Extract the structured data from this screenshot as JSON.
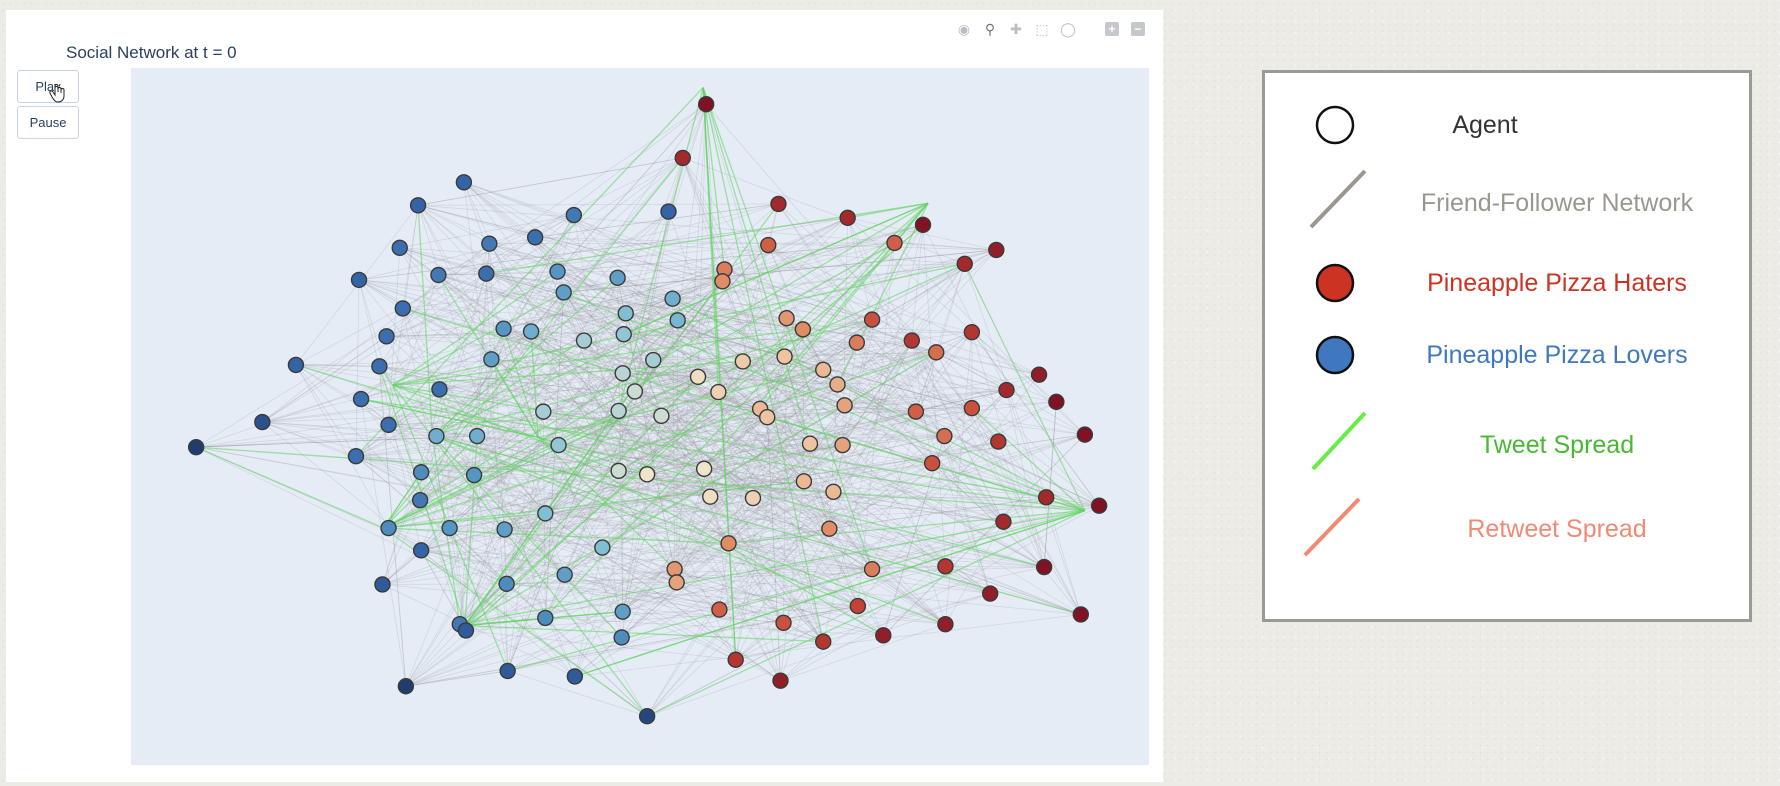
{
  "figure": {
    "title": "Social Network at t = 0",
    "controls": {
      "play_label": "Play",
      "pause_label": "Pause"
    },
    "modebar": [
      "camera-icon",
      "zoom-icon",
      "pan-icon",
      "box-select-icon",
      "lasso-icon",
      "zoom-in-icon",
      "zoom-out-icon"
    ],
    "colors": {
      "plot_bg": "#e5ecf6",
      "edge": "#9a9a9a",
      "tweet_edge": "#5fd35f",
      "node_outline": "#3a3a3a"
    }
  },
  "legend": {
    "items": [
      {
        "label": "Agent",
        "symbol": "circle-icon",
        "color": "#333333"
      },
      {
        "label": "Friend-Follower Network",
        "symbol": "grey-line-icon",
        "color": "#9a9790"
      },
      {
        "label": "Pineapple Pizza Haters",
        "symbol": "red-circle-icon",
        "color": "#cc3322"
      },
      {
        "label": "Pineapple Pizza Lovers",
        "symbol": "blue-circle-icon",
        "color": "#3f78bf"
      },
      {
        "label": "Tweet Spread",
        "symbol": "green-line-icon",
        "color": "#48b830"
      },
      {
        "label": "Retweet Spread",
        "symbol": "salmon-line-icon",
        "color": "#f08a75"
      }
    ]
  },
  "chart_data": {
    "type": "network",
    "title": "Social Network at t = 0",
    "xlim": [
      0,
      100
    ],
    "ylim": [
      0,
      100
    ],
    "grid": false,
    "opinion_scale": "opinion in [-1, 1]: -1 = dark blue (Pineapple Pizza Lovers), 0 = pale cream, +1 = dark red (Pineapple Pizza Haters)",
    "nodes": [
      {
        "x": 56.5,
        "y": 94.8,
        "o": 1.0
      },
      {
        "x": 6.4,
        "y": 45.6,
        "o": -1.0
      },
      {
        "x": 12.9,
        "y": 49.2,
        "o": -0.9
      },
      {
        "x": 16.2,
        "y": 57.4,
        "o": -0.8
      },
      {
        "x": 22.4,
        "y": 69.6,
        "o": -0.8
      },
      {
        "x": 32.7,
        "y": 83.6,
        "o": -0.8
      },
      {
        "x": 28.2,
        "y": 80.3,
        "o": -0.8
      },
      {
        "x": 43.5,
        "y": 78.9,
        "o": -0.7
      },
      {
        "x": 52.8,
        "y": 79.4,
        "o": -0.8
      },
      {
        "x": 54.2,
        "y": 87.1,
        "o": 0.9
      },
      {
        "x": 63.6,
        "y": 80.5,
        "o": 0.9
      },
      {
        "x": 70.4,
        "y": 78.5,
        "o": 0.9
      },
      {
        "x": 77.8,
        "y": 77.5,
        "o": 1.0
      },
      {
        "x": 85.0,
        "y": 73.9,
        "o": 0.95
      },
      {
        "x": 81.9,
        "y": 71.9,
        "o": 0.9
      },
      {
        "x": 62.6,
        "y": 74.6,
        "o": 0.7
      },
      {
        "x": 58.3,
        "y": 71.1,
        "o": 0.6
      },
      {
        "x": 39.7,
        "y": 75.7,
        "o": -0.75
      },
      {
        "x": 26.4,
        "y": 74.2,
        "o": -0.75
      },
      {
        "x": 35.2,
        "y": 74.8,
        "o": -0.7
      },
      {
        "x": 30.2,
        "y": 70.3,
        "o": -0.7
      },
      {
        "x": 41.9,
        "y": 70.8,
        "o": -0.55
      },
      {
        "x": 47.8,
        "y": 69.9,
        "o": -0.5
      },
      {
        "x": 53.2,
        "y": 66.9,
        "o": -0.4
      },
      {
        "x": 48.6,
        "y": 64.8,
        "o": -0.3
      },
      {
        "x": 42.5,
        "y": 67.8,
        "o": -0.5
      },
      {
        "x": 34.9,
        "y": 70.5,
        "o": -0.75
      },
      {
        "x": 26.7,
        "y": 65.5,
        "o": -0.75
      },
      {
        "x": 25.1,
        "y": 61.5,
        "o": -0.75
      },
      {
        "x": 36.6,
        "y": 62.6,
        "o": -0.55
      },
      {
        "x": 39.3,
        "y": 62.2,
        "o": -0.4
      },
      {
        "x": 35.4,
        "y": 58.2,
        "o": -0.5
      },
      {
        "x": 30.3,
        "y": 53.9,
        "o": -0.75
      },
      {
        "x": 22.6,
        "y": 52.5,
        "o": -0.75
      },
      {
        "x": 24.4,
        "y": 57.2,
        "o": -0.75
      },
      {
        "x": 44.5,
        "y": 60.9,
        "o": -0.2
      },
      {
        "x": 48.3,
        "y": 56.2,
        "o": -0.15
      },
      {
        "x": 48.4,
        "y": 61.8,
        "o": -0.25
      },
      {
        "x": 49.5,
        "y": 53.6,
        "o": -0.1
      },
      {
        "x": 53.7,
        "y": 63.8,
        "o": -0.35
      },
      {
        "x": 47.9,
        "y": 50.8,
        "o": -0.15
      },
      {
        "x": 55.7,
        "y": 55.7,
        "o": 0.1
      },
      {
        "x": 57.7,
        "y": 53.5,
        "o": 0.2
      },
      {
        "x": 60.1,
        "y": 57.9,
        "o": 0.25
      },
      {
        "x": 58.1,
        "y": 69.4,
        "o": 0.55
      },
      {
        "x": 64.4,
        "y": 64.1,
        "o": 0.5
      },
      {
        "x": 71.3,
        "y": 60.6,
        "o": 0.6
      },
      {
        "x": 64.2,
        "y": 58.6,
        "o": 0.3
      },
      {
        "x": 68.0,
        "y": 56.7,
        "o": 0.35
      },
      {
        "x": 72.8,
        "y": 63.9,
        "o": 0.75
      },
      {
        "x": 66.0,
        "y": 62.5,
        "o": 0.55
      },
      {
        "x": 76.7,
        "y": 60.9,
        "o": 0.85
      },
      {
        "x": 75.0,
        "y": 74.9,
        "o": 0.7
      },
      {
        "x": 79.1,
        "y": 59.2,
        "o": 0.65
      },
      {
        "x": 82.6,
        "y": 62.1,
        "o": 0.85
      },
      {
        "x": 82.6,
        "y": 51.2,
        "o": 0.75
      },
      {
        "x": 77.1,
        "y": 50.7,
        "o": 0.7
      },
      {
        "x": 69.4,
        "y": 54.6,
        "o": 0.4
      },
      {
        "x": 70.1,
        "y": 51.6,
        "o": 0.45
      },
      {
        "x": 61.8,
        "y": 51.1,
        "o": 0.35
      },
      {
        "x": 62.5,
        "y": 49.9,
        "o": 0.3
      },
      {
        "x": 66.7,
        "y": 46.1,
        "o": 0.3
      },
      {
        "x": 69.9,
        "y": 45.9,
        "o": 0.45
      },
      {
        "x": 79.9,
        "y": 47.2,
        "o": 0.65
      },
      {
        "x": 86.0,
        "y": 53.8,
        "o": 0.9
      },
      {
        "x": 89.2,
        "y": 56.0,
        "o": 0.95
      },
      {
        "x": 90.9,
        "y": 52.1,
        "o": 1.0
      },
      {
        "x": 93.7,
        "y": 47.4,
        "o": 1.0
      },
      {
        "x": 85.2,
        "y": 46.4,
        "o": 0.85
      },
      {
        "x": 78.7,
        "y": 43.3,
        "o": 0.75
      },
      {
        "x": 89.9,
        "y": 38.4,
        "o": 0.9
      },
      {
        "x": 95.1,
        "y": 37.2,
        "o": 1.0
      },
      {
        "x": 85.7,
        "y": 34.9,
        "o": 0.9
      },
      {
        "x": 69.0,
        "y": 39.2,
        "o": 0.35
      },
      {
        "x": 66.1,
        "y": 40.7,
        "o": 0.35
      },
      {
        "x": 61.1,
        "y": 38.3,
        "o": 0.2
      },
      {
        "x": 56.9,
        "y": 38.5,
        "o": 0.1
      },
      {
        "x": 47.9,
        "y": 42.2,
        "o": -0.1
      },
      {
        "x": 50.7,
        "y": 41.7,
        "o": 0.05
      },
      {
        "x": 56.3,
        "y": 42.5,
        "o": 0.05
      },
      {
        "x": 68.6,
        "y": 33.9,
        "o": 0.55
      },
      {
        "x": 58.7,
        "y": 31.8,
        "o": 0.55
      },
      {
        "x": 53.4,
        "y": 28.1,
        "o": 0.5
      },
      {
        "x": 72.8,
        "y": 28.1,
        "o": 0.6
      },
      {
        "x": 80.0,
        "y": 28.5,
        "o": 0.85
      },
      {
        "x": 89.7,
        "y": 28.4,
        "o": 1.0
      },
      {
        "x": 84.4,
        "y": 24.6,
        "o": 0.95
      },
      {
        "x": 93.3,
        "y": 21.6,
        "o": 1.0
      },
      {
        "x": 80.0,
        "y": 20.2,
        "o": 0.95
      },
      {
        "x": 71.4,
        "y": 22.8,
        "o": 0.8
      },
      {
        "x": 73.9,
        "y": 18.6,
        "o": 0.95
      },
      {
        "x": 68.0,
        "y": 17.7,
        "o": 0.85
      },
      {
        "x": 64.1,
        "y": 20.4,
        "o": 0.75
      },
      {
        "x": 57.8,
        "y": 22.3,
        "o": 0.7
      },
      {
        "x": 59.4,
        "y": 15.1,
        "o": 0.85
      },
      {
        "x": 63.8,
        "y": 12.1,
        "o": 0.95
      },
      {
        "x": 53.6,
        "y": 26.2,
        "o": 0.45
      },
      {
        "x": 48.3,
        "y": 22.0,
        "o": -0.5
      },
      {
        "x": 48.2,
        "y": 18.3,
        "o": -0.6
      },
      {
        "x": 42.6,
        "y": 27.3,
        "o": -0.5
      },
      {
        "x": 40.7,
        "y": 21.1,
        "o": -0.6
      },
      {
        "x": 36.9,
        "y": 26.0,
        "o": -0.6
      },
      {
        "x": 32.3,
        "y": 20.2,
        "o": -0.7
      },
      {
        "x": 32.9,
        "y": 19.3,
        "o": -0.85
      },
      {
        "x": 24.7,
        "y": 25.9,
        "o": -0.85
      },
      {
        "x": 28.5,
        "y": 30.8,
        "o": -0.8
      },
      {
        "x": 25.3,
        "y": 34.0,
        "o": -0.6
      },
      {
        "x": 31.3,
        "y": 34.0,
        "o": -0.55
      },
      {
        "x": 36.7,
        "y": 33.8,
        "o": -0.5
      },
      {
        "x": 40.7,
        "y": 36.1,
        "o": -0.3
      },
      {
        "x": 46.3,
        "y": 31.2,
        "o": -0.3
      },
      {
        "x": 28.4,
        "y": 38.0,
        "o": -0.7
      },
      {
        "x": 28.5,
        "y": 42.0,
        "o": -0.6
      },
      {
        "x": 33.7,
        "y": 41.6,
        "o": -0.55
      },
      {
        "x": 22.1,
        "y": 44.3,
        "o": -0.75
      },
      {
        "x": 30.0,
        "y": 47.2,
        "o": -0.4
      },
      {
        "x": 34.0,
        "y": 47.2,
        "o": -0.4
      },
      {
        "x": 42.0,
        "y": 45.9,
        "o": -0.25
      },
      {
        "x": 40.5,
        "y": 50.7,
        "o": -0.2
      },
      {
        "x": 51.3,
        "y": 58.1,
        "o": -0.2
      },
      {
        "x": 27.0,
        "y": 11.3,
        "o": -1.0
      },
      {
        "x": 37.0,
        "y": 13.5,
        "o": -0.85
      },
      {
        "x": 43.6,
        "y": 12.7,
        "o": -0.85
      },
      {
        "x": 50.7,
        "y": 7.0,
        "o": -0.95
      },
      {
        "x": 52.1,
        "y": 50.1,
        "o": -0.1
      },
      {
        "x": 25.3,
        "y": 48.8,
        "o": -0.75
      }
    ],
    "tweet_edges_note": "tweet-spread edges (green) radiate from a few hub agents across the network"
  }
}
